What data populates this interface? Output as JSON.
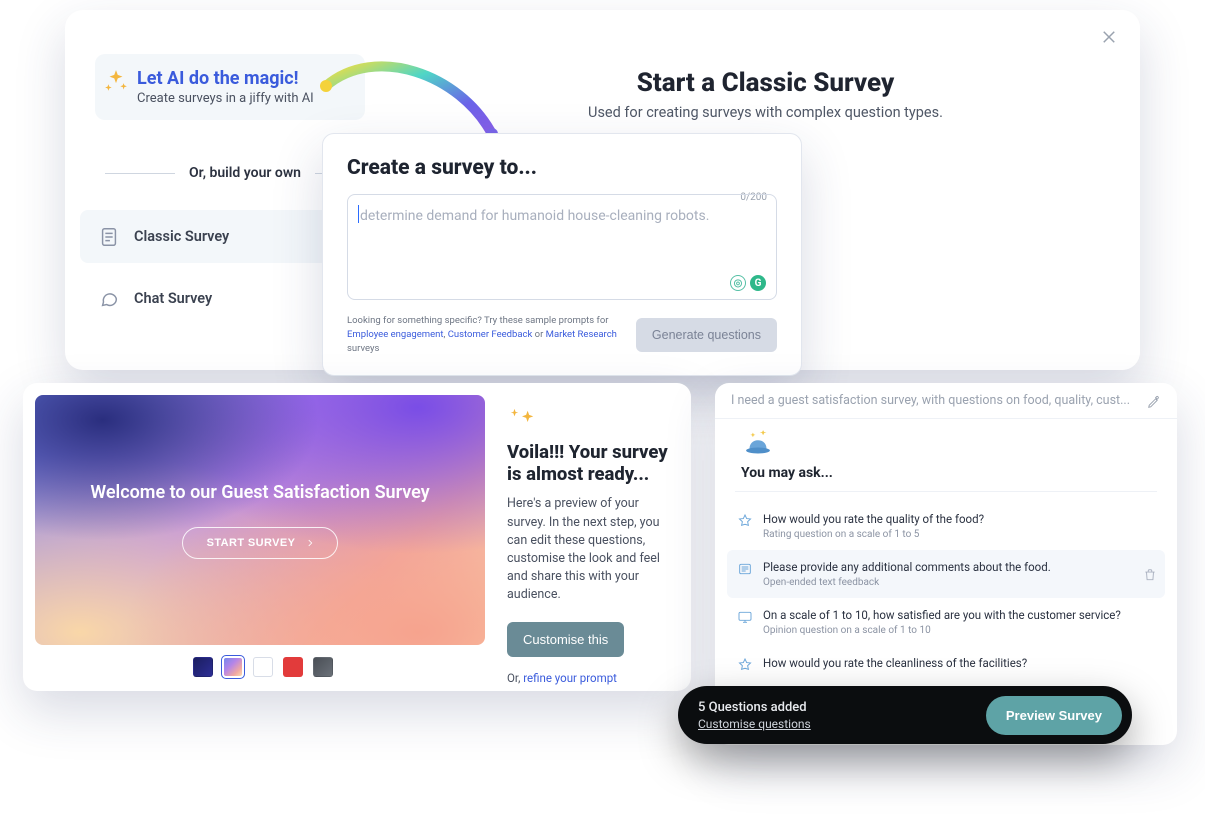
{
  "magic": {
    "title": "Let AI do the magic!",
    "subtitle": "Create surveys in a jiffy with AI"
  },
  "build_own_label": "Or, build your own",
  "type_options": {
    "classic": "Classic Survey",
    "chat": "Chat Survey"
  },
  "start": {
    "title": "Start a Classic Survey",
    "subtitle": "Used for creating surveys with complex question types."
  },
  "modal": {
    "heading": "Create a survey to...",
    "counter": "0/200",
    "placeholder": "determine demand for humanoid house-cleaning robots.",
    "hint_prefix": "Looking for something specific? Try these sample prompts for ",
    "hint_links": {
      "emp": "Employee engagement",
      "sep1": ", ",
      "cust": "Customer Feedback",
      "or": " or ",
      "mkt": "Market Research"
    },
    "hint_suffix": " surveys",
    "generate_label": "Generate questions"
  },
  "preview": {
    "hero_title": "Welcome to our Guest Satisfaction Survey",
    "hero_button": "START SURVEY",
    "voila_title": "Voila!!! Your survey is almost ready...",
    "voila_desc": "Here's a preview of your survey. In the next step, you can edit these questions, customise the look and feel and share this with your audience.",
    "customise_label": "Customise this",
    "refine_prefix": "Or, ",
    "refine_link": "refine your prompt",
    "swatches": [
      {
        "name": "dark",
        "bg": "linear-gradient(135deg,#1b1e60,#2d2e95)",
        "selected": false
      },
      {
        "name": "aurora",
        "bg": "linear-gradient(135deg,#7488ec,#b585e8 40%,#f1a8a2 75%,#fbdcb2)",
        "selected": true
      },
      {
        "name": "white",
        "bg": "#ffffff; border:1px solid #d8dde7",
        "selected": false
      },
      {
        "name": "red",
        "bg": "#e23b3b",
        "selected": false
      },
      {
        "name": "slate",
        "bg": "linear-gradient(135deg,#4a4f56,#6a7078)",
        "selected": false
      }
    ]
  },
  "questions": {
    "search_text": "I need a guest satisfaction survey, with questions on food, quality, cust...",
    "you_may_ask": "You may ask...",
    "items": [
      {
        "icon": "star",
        "text": "How would you rate the quality of the food?",
        "sub": "Rating question on a scale of 1 to 5",
        "hover": false
      },
      {
        "icon": "text",
        "text": "Please provide any additional comments about the food.",
        "sub": "Open-ended text feedback",
        "hover": true
      },
      {
        "icon": "screen",
        "text": "On a scale of 1 to 10, how satisfied are you with the customer service?",
        "sub": "Opinion question on a scale of 1 to 10",
        "hover": false
      },
      {
        "icon": "star",
        "text": "How would you rate the cleanliness of the facilities?",
        "sub": "",
        "hover": false
      }
    ]
  },
  "pill": {
    "title": "5 Questions added",
    "link": "Customise questions",
    "preview": "Preview Survey"
  }
}
